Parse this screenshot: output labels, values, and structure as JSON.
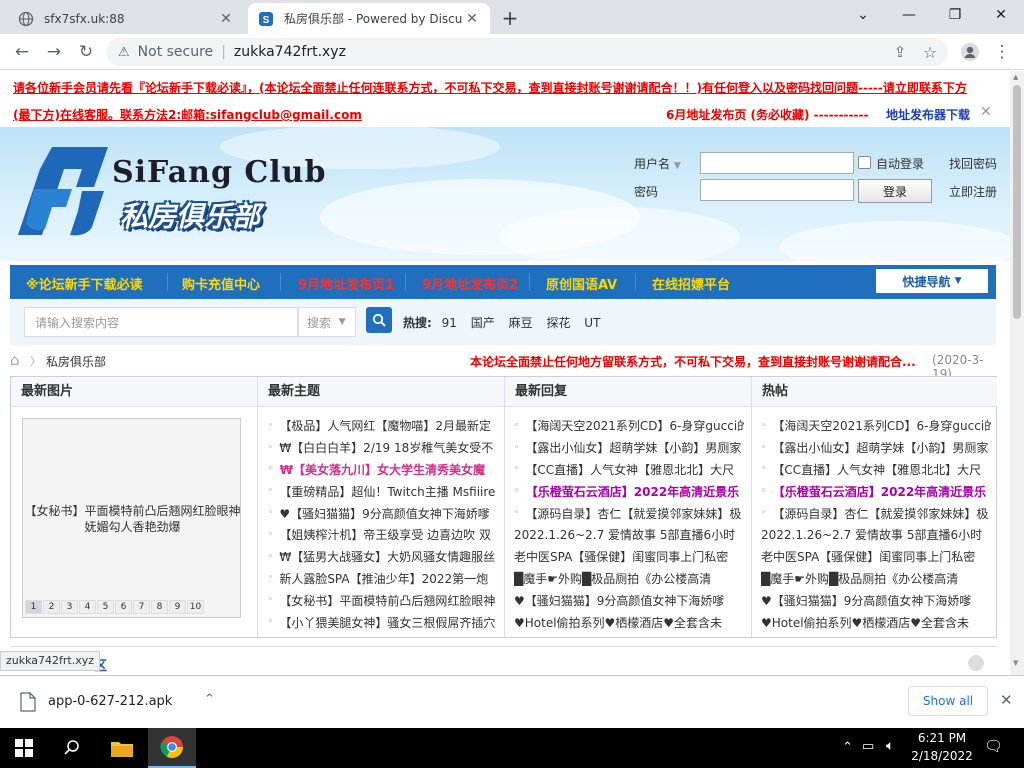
{
  "browser": {
    "tabs": [
      {
        "title": "sfx7sfx.uk:88",
        "active": false
      },
      {
        "title": "私房俱乐部 - Powered by Discuz!",
        "active": true
      }
    ],
    "new_tab": "+",
    "window_controls": {
      "minimize": "—",
      "maximize": "❐",
      "close": "✕"
    },
    "address": {
      "security": "Not secure",
      "url": "zukka742frt.xyz"
    }
  },
  "page": {
    "notice_line1": "请各位新手会员请先看『论坛新手下载必读』，(本论坛全面禁止任何连联系方式，不可私下交易，查到直接封账号谢谢请配合！！)有任何登入以及密码找回问题-----请立即联系下方",
    "notice_line2_left": "(最下方)在线客服。联系方法2:邮箱:sifangclub@gmail.com",
    "notice_line2_mid": "6月地址发布页  (务必收藏)  -----------",
    "notice_line2_right": "地址发布器下载",
    "logo": {
      "en": "SiFang Club",
      "cn": "私房俱乐部"
    },
    "login": {
      "username_label": "用户名",
      "password_label": "密码",
      "auto_login": "自动登录",
      "find_password": "找回密码",
      "login_button": "登录",
      "register": "立即注册"
    },
    "nav": [
      {
        "label": "※论坛新手下载必读",
        "color": "#ffd700"
      },
      {
        "label": "购卡充值中心",
        "color": "#ffd700"
      },
      {
        "label": "9月地址发布页1",
        "color": "#ff3030"
      },
      {
        "label": "9月地址发布页2",
        "color": "#ff3030"
      },
      {
        "label": "原创国语AV",
        "color": "#ffd700"
      },
      {
        "label": "在线招嫖平台",
        "color": "#ffd700"
      }
    ],
    "quick_nav": "快捷导航",
    "search": {
      "placeholder": "请输入搜索内容",
      "type": "搜索",
      "hot_label": "热搜:",
      "hot_terms": [
        "91",
        "国产",
        "麻豆",
        "探花",
        "UT"
      ]
    },
    "breadcrumb": {
      "home": "⌂",
      "current": "私房俱乐部",
      "announcement": "本论坛全面禁止任何地方留联系方式，不可私下交易，查到直接封账号谢谢请配合...",
      "date": "(2020-3-19)"
    },
    "columns": {
      "images": {
        "header": "最新图片",
        "caption": "【女秘书】平面模特前凸后翘网红脸眼神妩媚勾人香艳劲爆",
        "pages": [
          "1",
          "2",
          "3",
          "4",
          "5",
          "6",
          "7",
          "8",
          "9",
          "10"
        ]
      },
      "new_topics": {
        "header": "最新主题",
        "items": [
          {
            "text": "【极品】人气网红【魔物喵】2月最新定",
            "style": ""
          },
          {
            "text": "₩【白白白羊】2/19 18岁稚气美女受不",
            "style": ""
          },
          {
            "text": "₩【美女落九川】女大学生清秀美女魔",
            "style": "hlr"
          },
          {
            "text": "【重磅精品】超仙！Twitch主播 Msfiiire",
            "style": ""
          },
          {
            "text": "♥【骚妇猫猫】9分高颜值女神下海娇嗲",
            "style": ""
          },
          {
            "text": "【姐姨榨汁机】帝王级享受 边喜边吹 双",
            "style": ""
          },
          {
            "text": "₩【猛男大战骚女】大奶风骚女情趣服丝",
            "style": ""
          },
          {
            "text": "新人露脸SPA【推油少年】2022第一炮",
            "style": ""
          },
          {
            "text": "【女秘书】平面模特前凸后翘网红脸眼神",
            "style": ""
          },
          {
            "text": "【小丫猥美腿女神】骚女三根假屌齐插穴",
            "style": ""
          }
        ]
      },
      "new_replies": {
        "header": "最新回复",
        "items": [
          {
            "text": "【海阔天空2021系列CD】6-身穿gucci的",
            "style": ""
          },
          {
            "text": "【露出小仙女】超萌学妹【小韵】男厕家",
            "style": ""
          },
          {
            "text": "【CC直播】人气女神【雅恩北北】大尺",
            "style": ""
          },
          {
            "text": "【乐橙萤石云酒店】2022年高清近景乐",
            "style": "hl"
          },
          {
            "text": "【源码自录】杏仁【就爱摸邻家妹妹】极",
            "style": ""
          },
          {
            "text": "2022.1.26~2.7 爱情故事 5部直播6小时",
            "style": ""
          },
          {
            "text": "老中医SPA【骚保健】闺蜜同事上门私密",
            "style": ""
          },
          {
            "text": "█魔手☛外购█极品厕拍《办公楼高清",
            "style": ""
          },
          {
            "text": "♥【骚妇猫猫】9分高颜值女神下海娇嗲",
            "style": ""
          },
          {
            "text": "♥Hotel偷拍系列♥栖檬酒店♥全套含未",
            "style": ""
          }
        ]
      },
      "hot_posts": {
        "header": "热帖",
        "items": [
          {
            "text": "【海阔天空2021系列CD】6-身穿gucci的",
            "style": ""
          },
          {
            "text": "【露出小仙女】超萌学妹【小韵】男厕家",
            "style": ""
          },
          {
            "text": "【CC直播】人气女神【雅恩北北】大尺",
            "style": ""
          },
          {
            "text": "【乐橙萤石云酒店】2022年高清近景乐",
            "style": "hl"
          },
          {
            "text": "【源码自录】杏仁【就爱摸邻家妹妹】极",
            "style": ""
          },
          {
            "text": "2022.1.26~2.7 爱情故事 5部直播6小时",
            "style": ""
          },
          {
            "text": "老中医SPA【骚保健】闺蜜同事上门私密",
            "style": ""
          },
          {
            "text": "█魔手☛外购█极品厕拍《办公楼高清",
            "style": ""
          },
          {
            "text": "♥【骚妇猫猫】9分高颜值女神下海娇嗲",
            "style": ""
          },
          {
            "text": "♥Hotel偷拍系列♥栖檬酒店♥全套含未",
            "style": ""
          }
        ]
      }
    },
    "bottom_partial": "区"
  },
  "status_url": "zukka742frt.xyz",
  "download": {
    "filename": "app-0-627-212.apk",
    "show_all": "Show all"
  },
  "taskbar": {
    "time": "6:21 PM",
    "date": "2/18/2022"
  }
}
